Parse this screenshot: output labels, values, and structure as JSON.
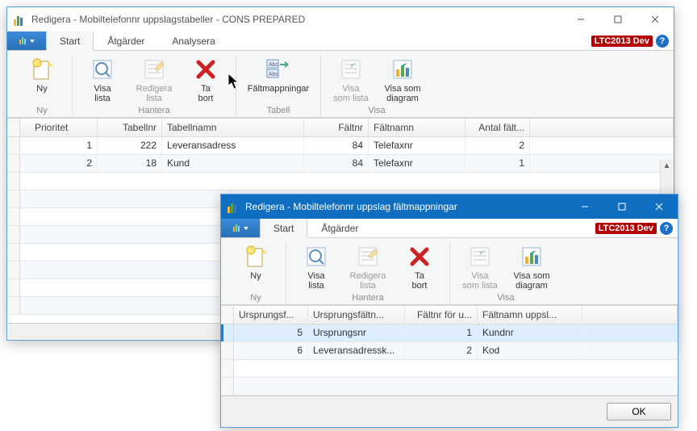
{
  "win1": {
    "title": "Redigera - Mobiltelefonnr uppslagstabeller - CONS PREPARED",
    "tabs": {
      "start": "Start",
      "actions": "Åtgärder",
      "analyze": "Analysera"
    },
    "badge": "LTC2013 Dev",
    "ribbon": {
      "ny": "Ny",
      "visa_lista": "Visa\nlista",
      "redigera_lista": "Redigera\nlista",
      "ta_bort": "Ta\nbort",
      "faltmappningar": "Fältmappningar",
      "visa_som_lista": "Visa\nsom lista",
      "visa_som_diagram": "Visa som\ndiagram",
      "g_ny": "Ny",
      "g_hantera": "Hantera",
      "g_tabell": "Tabell",
      "g_visa": "Visa"
    },
    "columns": {
      "prioritet": "Prioritet",
      "tabellnr": "Tabellnr",
      "tabellnamn": "Tabellnamn",
      "faltnr": "Fältnr",
      "faltnamn": "Fältnamn",
      "antal": "Antal fält..."
    },
    "rows": [
      {
        "prioritet": "1",
        "tabellnr": "222",
        "tabellnamn": "Leveransadress",
        "faltnr": "84",
        "faltnamn": "Telefaxnr",
        "antal": "2"
      },
      {
        "prioritet": "2",
        "tabellnr": "18",
        "tabellnamn": "Kund",
        "faltnr": "84",
        "faltnamn": "Telefaxnr",
        "antal": "1"
      }
    ]
  },
  "win2": {
    "title": "Redigera - Mobiltelefonnr uppslag fältmappningar",
    "tabs": {
      "start": "Start",
      "actions": "Åtgärder"
    },
    "badge": "LTC2013 Dev",
    "ribbon": {
      "ny": "Ny",
      "visa_lista": "Visa\nlista",
      "redigera_lista": "Redigera\nlista",
      "ta_bort": "Ta\nbort",
      "visa_som_lista": "Visa\nsom lista",
      "visa_som_diagram": "Visa som\ndiagram",
      "g_ny": "Ny",
      "g_hantera": "Hantera",
      "g_visa": "Visa"
    },
    "columns": {
      "ursprungsf": "Ursprungsf...",
      "ursprungsfalt": "Ursprungsfältn...",
      "faltnr": "Fältnr för u...",
      "faltnamn": "Fältnamn uppsl..."
    },
    "rows": [
      {
        "ursprungsf": "5",
        "ursprungsfalt": "Ursprungsnr",
        "faltnr": "1",
        "faltnamn": "Kundnr"
      },
      {
        "ursprungsf": "6",
        "ursprungsfalt": "Leveransadressk...",
        "faltnr": "2",
        "faltnamn": "Kod"
      }
    ],
    "ok": "OK"
  }
}
